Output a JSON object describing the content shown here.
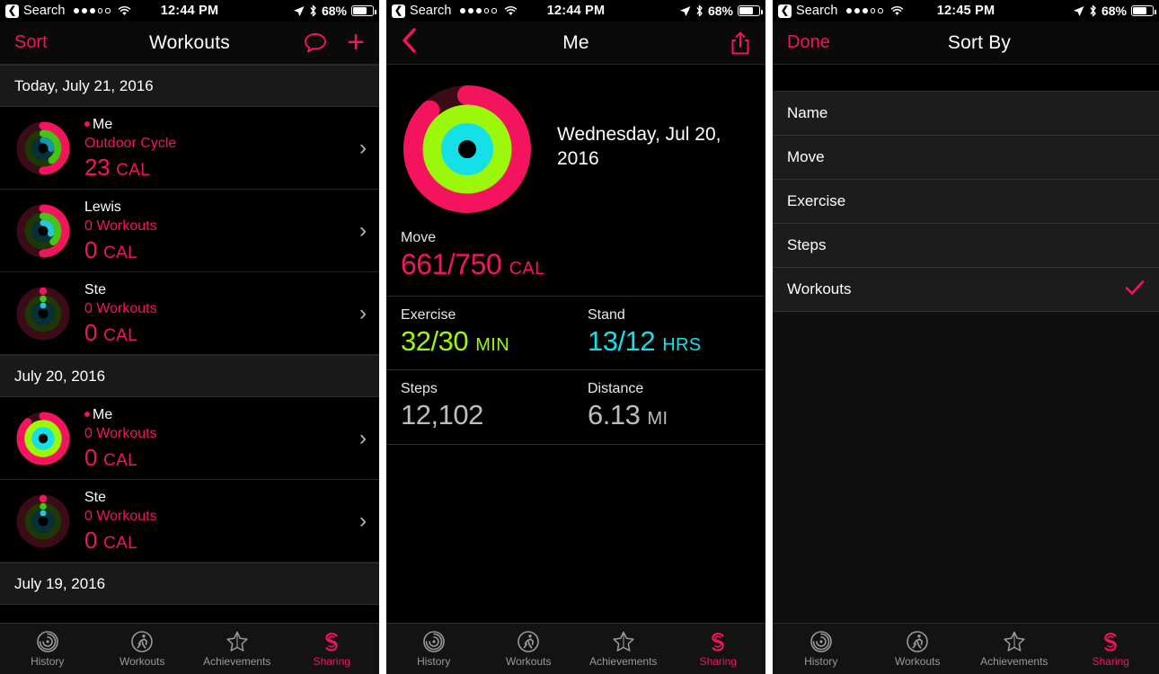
{
  "colors": {
    "accent_pink": "#f4145e",
    "move_ring": "#f4145e",
    "exercise_ring": "#9cf80a",
    "stand_ring": "#14e0e8",
    "background": "#000000",
    "row_background": "#000000",
    "section_header_background": "#191919",
    "sort_item_background": "#1c1c1c",
    "inactive_tab": "#9a9a9a"
  },
  "panels": [
    {
      "status_bar": {
        "back_label": "Search",
        "back_icon": "back-chevron-icon",
        "signal_dots_filled": 3,
        "signal_dots_total": 5,
        "wifi_icon": "wifi-icon",
        "time": "12:44 PM",
        "location_icon": "location-arrow-icon",
        "bluetooth_icon": "bluetooth-icon",
        "battery_percent": "68%",
        "battery_icon": "battery-icon"
      },
      "nav": {
        "left_label": "Sort",
        "title": "Workouts",
        "message_icon": "message-bubble-icon",
        "add_icon": "plus-icon"
      },
      "sections": [
        {
          "header": "Today, July 21, 2016",
          "rows": [
            {
              "name": "Me",
              "has_me_dot": true,
              "subtitle": "Outdoor Cycle",
              "calories": "23",
              "calories_unit": "CAL",
              "rings": {
                "move": 0.5,
                "exercise": 0.4,
                "stand": 0.26
              },
              "chevron": "chevron-right-icon"
            },
            {
              "name": "Lewis",
              "has_me_dot": false,
              "subtitle": "0 Workouts",
              "calories": "0",
              "calories_unit": "CAL",
              "rings": {
                "move": 0.5,
                "exercise": 0.38,
                "stand": 0.3
              },
              "chevron": "chevron-right-icon"
            },
            {
              "name": "Ste",
              "has_me_dot": false,
              "subtitle": "0 Workouts",
              "calories": "0",
              "calories_unit": "CAL",
              "rings": {
                "move": 0.01,
                "exercise": 0.01,
                "stand": 0.01
              },
              "chevron": "chevron-right-icon"
            }
          ]
        },
        {
          "header": "July 20, 2016",
          "rows": [
            {
              "name": "Me",
              "has_me_dot": true,
              "subtitle": "0 Workouts",
              "calories": "0",
              "calories_unit": "CAL",
              "rings": {
                "move": 0.88,
                "exercise": 1.0,
                "stand": 1.0
              },
              "chevron": "chevron-right-icon"
            },
            {
              "name": "Ste",
              "has_me_dot": false,
              "subtitle": "0 Workouts",
              "calories": "0",
              "calories_unit": "CAL",
              "rings": {
                "move": 0.01,
                "exercise": 0.01,
                "stand": 0.01
              },
              "chevron": "chevron-right-icon"
            }
          ]
        },
        {
          "header": "July 19, 2016",
          "rows": []
        }
      ]
    },
    {
      "status_bar": {
        "back_label": "Search",
        "time": "12:44 PM",
        "battery_percent": "68%"
      },
      "nav": {
        "back_icon": "back-chevron-icon",
        "title": "Me",
        "has_me_dot": true,
        "share_icon": "share-icon"
      },
      "date": "Wednesday, Jul 20, 2016",
      "rings": {
        "move": 0.88,
        "exercise": 1.0,
        "stand": 1.0
      },
      "stats": [
        {
          "label": "Move",
          "value": "661/750",
          "unit": "CAL",
          "color_key": "move"
        },
        {
          "label": "Exercise",
          "value": "32/30",
          "unit": "MIN",
          "color_key": "exercise"
        },
        {
          "label": "Stand",
          "value": "13/12",
          "unit": "HRS",
          "color_key": "stand"
        },
        {
          "label": "Steps",
          "value": "12,102",
          "unit": "",
          "color_key": "plain"
        },
        {
          "label": "Distance",
          "value": "6.13",
          "unit": "MI",
          "color_key": "plain"
        }
      ]
    },
    {
      "status_bar": {
        "back_label": "Search",
        "time": "12:45 PM",
        "battery_percent": "68%"
      },
      "nav": {
        "left_label": "Done",
        "title": "Sort By"
      },
      "options": [
        {
          "label": "Name",
          "selected": false
        },
        {
          "label": "Move",
          "selected": false
        },
        {
          "label": "Exercise",
          "selected": false
        },
        {
          "label": "Steps",
          "selected": false
        },
        {
          "label": "Workouts",
          "selected": true
        }
      ],
      "check_icon": "checkmark-icon"
    }
  ],
  "tabbar": {
    "items": [
      {
        "label": "History",
        "icon": "history-rings-icon",
        "active": false
      },
      {
        "label": "Workouts",
        "icon": "runner-icon",
        "active": false
      },
      {
        "label": "Achievements",
        "icon": "star-icon",
        "active": false
      },
      {
        "label": "Sharing",
        "icon": "sharing-s-icon",
        "active": true
      }
    ]
  }
}
